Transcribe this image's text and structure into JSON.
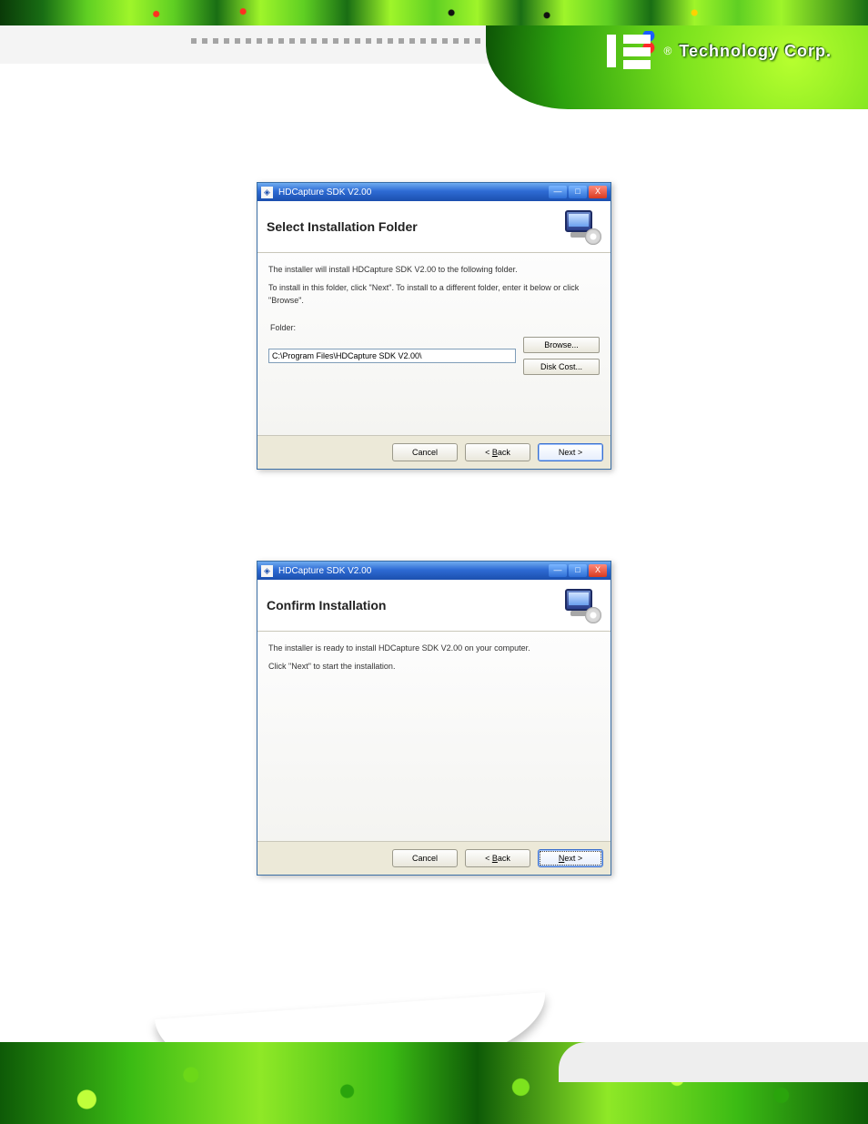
{
  "brand": {
    "registered": "®",
    "name": "Technology Corp."
  },
  "window1": {
    "title": "HDCapture SDK V2.00",
    "heading": "Select Installation Folder",
    "line1": "The installer will install HDCapture SDK V2.00 to the following folder.",
    "line2": "To install in this folder, click \"Next\". To install to a different folder, enter it below or click \"Browse\".",
    "folder_label": "Folder:",
    "folder_value": "C:\\Program Files\\HDCapture SDK V2.00\\",
    "browse": "Browse...",
    "disk_cost": "Disk Cost...",
    "cancel": "Cancel",
    "back_prefix": "< ",
    "back_letter": "B",
    "back_rest": "ack",
    "next": "Next >"
  },
  "window2": {
    "title": "HDCapture SDK V2.00",
    "heading": "Confirm Installation",
    "line1": "The installer is ready to install HDCapture SDK V2.00 on your computer.",
    "line2": "Click \"Next\" to start the installation.",
    "cancel": "Cancel",
    "back_prefix": "< ",
    "back_letter": "B",
    "back_rest": "ack",
    "next_letter": "N",
    "next_rest": "ext >"
  },
  "controls": {
    "min": "—",
    "max": "□",
    "close": "X"
  }
}
